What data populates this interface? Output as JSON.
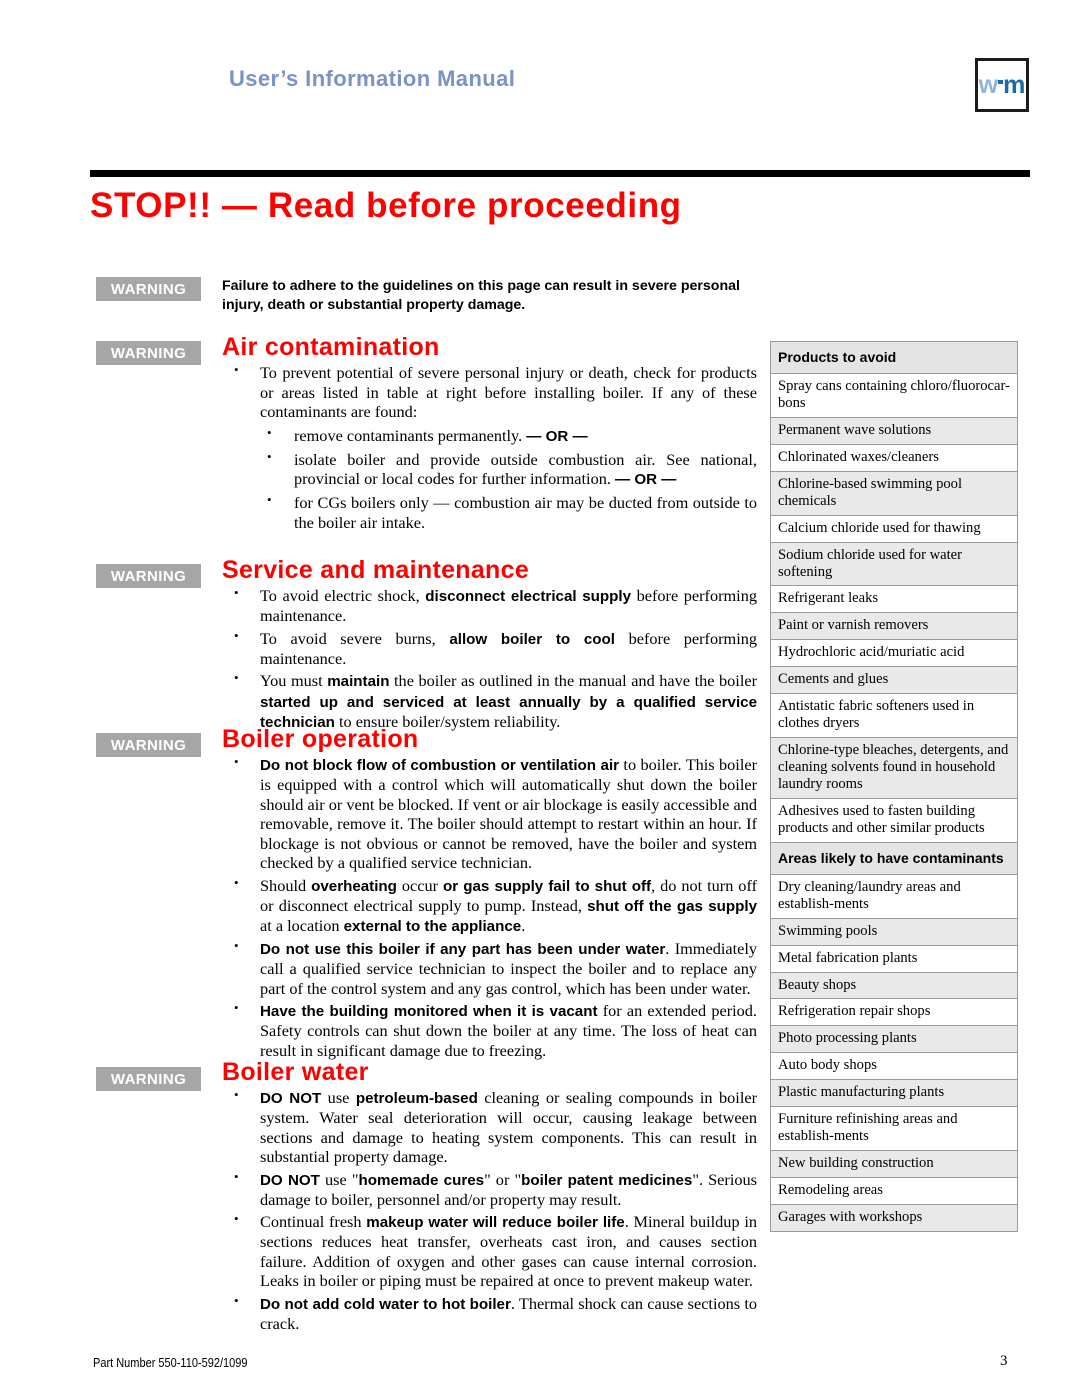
{
  "header": {
    "manual_title": "User’s Information Manual",
    "logo_w": "w",
    "logo_m": "m"
  },
  "title": {
    "main": "STOP!! — Read before proceeding"
  },
  "badges": {
    "warning_label": "WARNING"
  },
  "intro": {
    "text_plain": "Failure to adhere to the guidelines on this page can result in severe personal injury, death or substantial property damage."
  },
  "sections": [
    {
      "id": "air-contamination",
      "heading": "Air contamination",
      "bullets": [
        {
          "parts": [
            {
              "t": "To prevent potential of severe personal injury or death, check for products or areas listed in table at right before installing boiler. If any of these contaminants are found:",
              "b": false
            }
          ],
          "sub": [
            {
              "parts": [
                {
                  "t": "remove contaminants permanently.",
                  "b": false
                },
                {
                  "t": "        ",
                  "b": false
                },
                {
                  "t": "— OR —",
                  "b": true
                }
              ]
            },
            {
              "parts": [
                {
                  "t": "isolate boiler and provide outside combustion air. See national, provincial or local codes for further information.",
                  "b": false
                },
                {
                  "t": "      ",
                  "b": false
                },
                {
                  "t": "— OR —",
                  "b": true
                }
              ]
            },
            {
              "parts": [
                {
                  "t": "for CGs boilers only — combustion air may be ducted from outside to the boiler air intake.",
                  "b": false
                }
              ]
            }
          ]
        }
      ]
    },
    {
      "id": "service-and-maintenance",
      "heading": "Service and maintenance",
      "bullets": [
        {
          "parts": [
            {
              "t": "To avoid electric shock, ",
              "b": false
            },
            {
              "t": "disconnect electrical supply",
              "b": true
            },
            {
              "t": " before performing maintenance.",
              "b": false
            }
          ]
        },
        {
          "parts": [
            {
              "t": "To avoid severe burns, ",
              "b": false
            },
            {
              "t": "allow boiler to cool",
              "b": true
            },
            {
              "t": " before performing maintenance.",
              "b": false
            }
          ]
        },
        {
          "parts": [
            {
              "t": "You must ",
              "b": false
            },
            {
              "t": "maintain",
              "b": true
            },
            {
              "t": " the boiler as outlined in the manual and have the boiler ",
              "b": false
            },
            {
              "t": "started up and serviced at least annually by a qualified service technician",
              "b": true
            },
            {
              "t": " to ensure boiler/system reliability.",
              "b": false
            }
          ]
        }
      ]
    },
    {
      "id": "boiler-operation",
      "heading": "Boiler operation",
      "bullets": [
        {
          "parts": [
            {
              "t": "Do not block flow of combustion or ventilation air",
              "b": true
            },
            {
              "t": " to boiler. This boiler is equipped with a control which will automatically shut down the boiler should air or vent be blocked. If vent or air blockage is easily accessible and removable, remove it. The boiler should attempt to restart within an hour. If blockage is not obvious or cannot be removed, have the boiler and system checked by a qualified service technician.",
              "b": false
            }
          ]
        },
        {
          "parts": [
            {
              "t": "Should ",
              "b": false
            },
            {
              "t": "overheating",
              "b": true
            },
            {
              "t": " occur ",
              "b": false
            },
            {
              "t": "or gas supply fail to shut off",
              "b": true
            },
            {
              "t": ", do not turn off or disconnect electrical supply to pump. Instead, ",
              "b": false
            },
            {
              "t": "shut off the gas supply",
              "b": true
            },
            {
              "t": " at a location ",
              "b": false
            },
            {
              "t": "external to the appliance",
              "b": true
            },
            {
              "t": ".",
              "b": false
            }
          ]
        },
        {
          "parts": [
            {
              "t": "Do not use this boiler if any part has been under water",
              "b": true
            },
            {
              "t": ". Immediately call a qualified service technician to inspect the boiler and to replace any part of the control system and any gas control, which has been under water.",
              "b": false
            }
          ]
        },
        {
          "parts": [
            {
              "t": "Have the building monitored when it is vacant",
              "b": true
            },
            {
              "t": " for an extended period. Safety controls can shut down the boiler at any time. The loss of heat can result in significant damage due to freezing.",
              "b": false
            }
          ]
        }
      ]
    },
    {
      "id": "boiler-water",
      "heading": "Boiler water",
      "bullets": [
        {
          "parts": [
            {
              "t": "DO NOT",
              "b": true
            },
            {
              "t": " use ",
              "b": false
            },
            {
              "t": "petroleum-based",
              "b": true
            },
            {
              "t": " cleaning or sealing compounds in boiler system. Water seal deterioration will occur, causing leakage between sections and damage to heating system components. This can result in substantial property damage.",
              "b": false
            }
          ]
        },
        {
          "parts": [
            {
              "t": "DO NOT",
              "b": true
            },
            {
              "t": " use \"",
              "b": false
            },
            {
              "t": "homemade cures",
              "b": true
            },
            {
              "t": "\" or \"",
              "b": false
            },
            {
              "t": "boiler patent medicines",
              "b": true
            },
            {
              "t": "\". Serious damage to boiler, personnel and/or property may result.",
              "b": false
            }
          ]
        },
        {
          "parts": [
            {
              "t": "Continual fresh ",
              "b": false
            },
            {
              "t": "makeup water will reduce boiler life",
              "b": true
            },
            {
              "t": ". Mineral buildup in sections reduces heat transfer, overheats cast iron, and causes section failure. Addition of oxygen and other gases can cause internal corrosion. Leaks in boiler or piping must be repaired at once to prevent makeup water.",
              "b": false
            }
          ]
        },
        {
          "parts": [
            {
              "t": "Do not add cold water to hot boiler",
              "b": true
            },
            {
              "t": ". Thermal shock can cause sections to crack.",
              "b": false
            }
          ]
        }
      ]
    }
  ],
  "side_table": {
    "rows": [
      {
        "text": "Products to avoid",
        "kind": "head"
      },
      {
        "text": "Spray cans containing chloro/fluorocar-bons",
        "kind": "cell",
        "shade": false
      },
      {
        "text": "Permanent wave solutions",
        "kind": "cell",
        "shade": true
      },
      {
        "text": "Chlorinated waxes/cleaners",
        "kind": "cell",
        "shade": false
      },
      {
        "text": "Chlorine-based swimming pool chemicals",
        "kind": "cell",
        "shade": true
      },
      {
        "text": "Calcium chloride used for thawing",
        "kind": "cell",
        "shade": false
      },
      {
        "text": "Sodium chloride used for water softening",
        "kind": "cell",
        "shade": true
      },
      {
        "text": "Refrigerant leaks",
        "kind": "cell",
        "shade": false
      },
      {
        "text": "Paint or varnish removers",
        "kind": "cell",
        "shade": true
      },
      {
        "text": "Hydrochloric acid/muriatic acid",
        "kind": "cell",
        "shade": false
      },
      {
        "text": "Cements and glues",
        "kind": "cell",
        "shade": true
      },
      {
        "text": "Antistatic fabric softeners used in clothes dryers",
        "kind": "cell",
        "shade": false
      },
      {
        "text": "Chlorine-type bleaches, detergents, and cleaning solvents found in household laundry rooms",
        "kind": "cell",
        "shade": true
      },
      {
        "text": "Adhesives used to fasten building products and other similar products",
        "kind": "cell",
        "shade": false
      },
      {
        "text": "Areas likely to have contaminants",
        "kind": "head"
      },
      {
        "text": "Dry cleaning/laundry areas and establish-ments",
        "kind": "cell",
        "shade": false
      },
      {
        "text": "Swimming pools",
        "kind": "cell",
        "shade": true
      },
      {
        "text": "Metal fabrication plants",
        "kind": "cell",
        "shade": false
      },
      {
        "text": "Beauty shops",
        "kind": "cell",
        "shade": true
      },
      {
        "text": "Refrigeration repair shops",
        "kind": "cell",
        "shade": false
      },
      {
        "text": "Photo processing plants",
        "kind": "cell",
        "shade": true
      },
      {
        "text": "Auto body shops",
        "kind": "cell",
        "shade": false
      },
      {
        "text": "Plastic manufacturing plants",
        "kind": "cell",
        "shade": true
      },
      {
        "text": "Furniture refinishing areas and establish-ments",
        "kind": "cell",
        "shade": false
      },
      {
        "text": "New building construction",
        "kind": "cell",
        "shade": true
      },
      {
        "text": "Remodeling areas",
        "kind": "cell",
        "shade": false
      },
      {
        "text": "Garages with workshops",
        "kind": "cell",
        "shade": true
      }
    ]
  },
  "footer": {
    "part_number": "Part Number 550-110-592/1099",
    "page_number": "3"
  }
}
